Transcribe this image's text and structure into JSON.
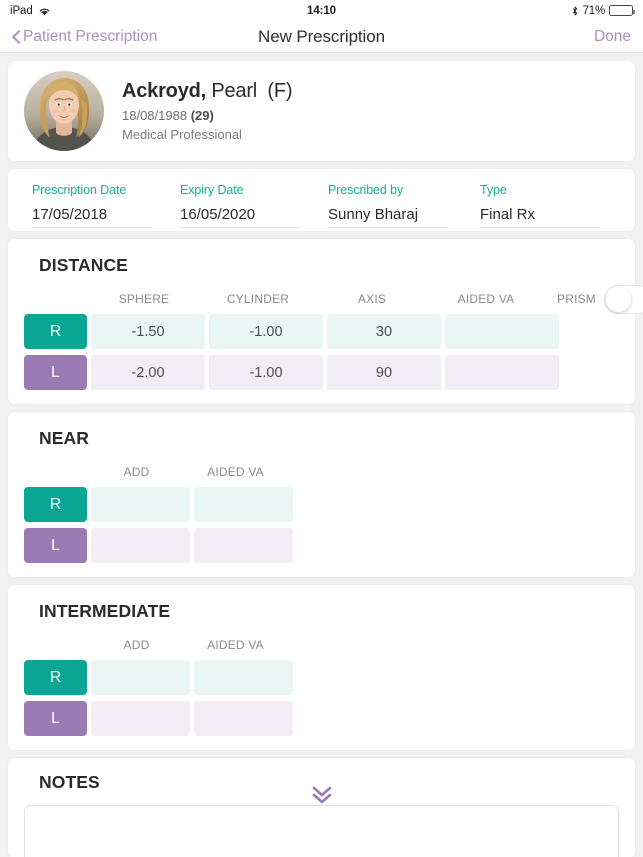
{
  "status_bar": {
    "device": "iPad",
    "wifi_icon": "wifi-icon",
    "time": "14:10",
    "bluetooth_icon": "bluetooth-icon",
    "battery_percent": "71%",
    "battery_icon": "battery-icon"
  },
  "nav": {
    "back_label": "Patient Prescription",
    "back_icon": "chevron-left-icon",
    "title": "New Prescription",
    "done_label": "Done"
  },
  "patient": {
    "avatar_name": "patient-avatar",
    "surname": "Ackroyd,",
    "given_name": "Pearl",
    "gender": "(F)",
    "dob": "18/08/1988",
    "age": "(29)",
    "role": "Medical Professional"
  },
  "details": {
    "fields": [
      {
        "label": "Prescription Date",
        "value": "17/05/2018"
      },
      {
        "label": "Expiry Date",
        "value": "16/05/2020"
      },
      {
        "label": "Prescribed by",
        "value": "Sunny Bharaj"
      },
      {
        "label": "Type",
        "value": "Final Rx"
      }
    ]
  },
  "distance": {
    "title": "DISTANCE",
    "columns": [
      "SPHERE",
      "CYLINDER",
      "AXIS",
      "AIDED VA"
    ],
    "prism_label": "PRISM",
    "prism_on": false,
    "rows": [
      {
        "eye": "R",
        "values": [
          "-1.50",
          "-1.00",
          "30",
          ""
        ]
      },
      {
        "eye": "L",
        "values": [
          "-2.00",
          "-1.00",
          "90",
          ""
        ]
      }
    ]
  },
  "near": {
    "title": "NEAR",
    "columns": [
      "ADD",
      "AIDED VA"
    ],
    "rows": [
      {
        "eye": "R",
        "values": [
          "",
          ""
        ]
      },
      {
        "eye": "L",
        "values": [
          "",
          ""
        ]
      }
    ]
  },
  "intermediate": {
    "title": "INTERMEDIATE",
    "columns": [
      "ADD",
      "AIDED VA"
    ],
    "rows": [
      {
        "eye": "R",
        "values": [
          "",
          ""
        ]
      },
      {
        "eye": "L",
        "values": [
          "",
          ""
        ]
      }
    ]
  },
  "notes": {
    "title": "NOTES",
    "value": "",
    "scroll_hint_icon": "double-chevron-down-icon"
  },
  "colors": {
    "accent_teal": "#1aab9b",
    "eye_right": "#0aa693",
    "eye_left": "#9b79b3",
    "nav_tint": "#ab8fc0",
    "page_bg": "#f1f1f2"
  }
}
